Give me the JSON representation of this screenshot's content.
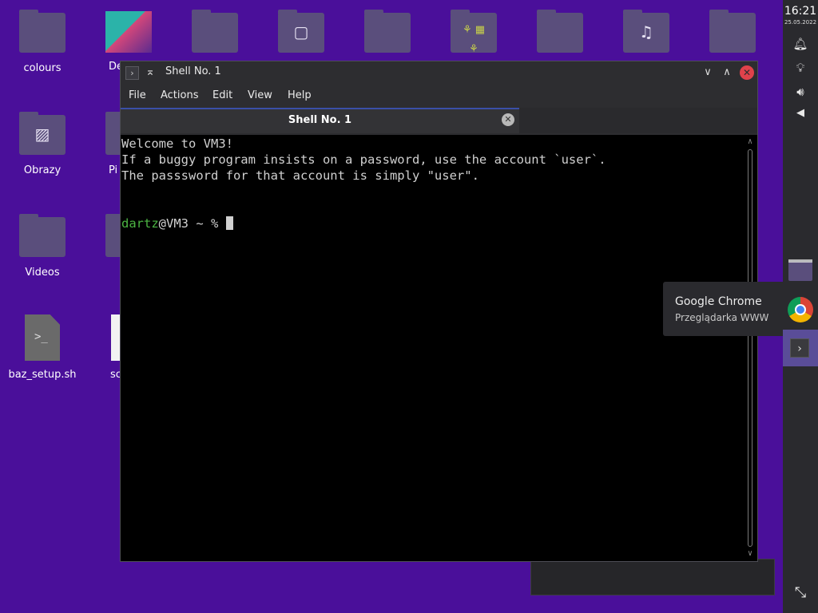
{
  "desktop": {
    "icons": [
      {
        "label": "colours"
      },
      {
        "label": "De"
      },
      {
        "label": "Obrazy"
      },
      {
        "label": "Pi"
      },
      {
        "label": "Videos"
      },
      {
        "label": "baz_setup.sh"
      },
      {
        "label": "sc"
      }
    ]
  },
  "window": {
    "title": "Shell No. 1",
    "menu": [
      "File",
      "Actions",
      "Edit",
      "View",
      "Help"
    ],
    "tab_label": "Shell No. 1"
  },
  "terminal": {
    "lines": [
      "Welcome to VM3!",
      "If a buggy program insists on a password, use the account `user`.",
      "The passsword for that account is simply \"user\"."
    ],
    "prompt_user": "dartz",
    "prompt_host": "@VM3 ~ % "
  },
  "panel": {
    "time": "16:21",
    "date": "25.05.2022"
  },
  "tooltip": {
    "title": "Google Chrome",
    "subtitle": "Przeglądarka WWW"
  },
  "colors": {
    "desktop_bg": "#4a0f9a",
    "prompt_user": "#4cb543",
    "close_button": "#e0424b"
  }
}
